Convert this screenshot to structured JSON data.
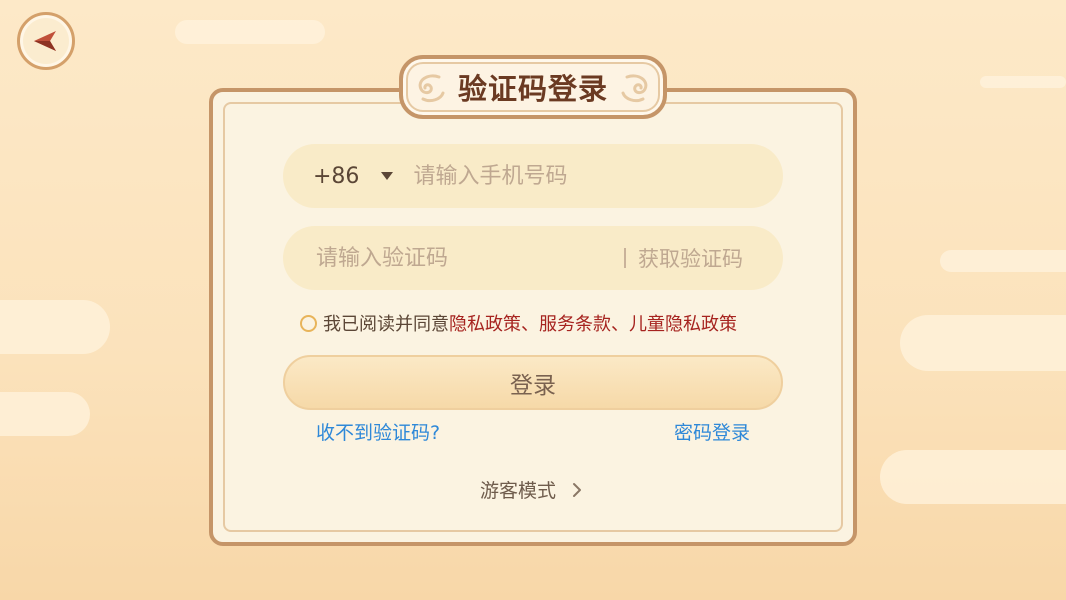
{
  "title": "验证码登录",
  "phone": {
    "country_code": "+86",
    "placeholder": "请输入手机号码",
    "value": ""
  },
  "code": {
    "placeholder": "请输入验证码",
    "value": "",
    "get_code_label": "获取验证码"
  },
  "agreement": {
    "checked": false,
    "prefix": "我已阅读并同意",
    "privacy_policy": "隐私政策",
    "separator1": "、",
    "terms": "服务条款",
    "separator2": "、",
    "child_privacy": "儿童隐私政策"
  },
  "login_label": "登录",
  "links": {
    "no_code": "收不到验证码?",
    "password_login": "密码登录"
  },
  "guest_mode": "游客模式",
  "icons": {
    "back": "back-arrow-icon",
    "dropdown": "caret-down-icon",
    "guest": "chevron-right-icon"
  },
  "colors": {
    "accent_link": "#2e88d8",
    "policy_red": "#a6231f",
    "title_brown": "#6b3a22",
    "frame_border": "#c59568"
  }
}
